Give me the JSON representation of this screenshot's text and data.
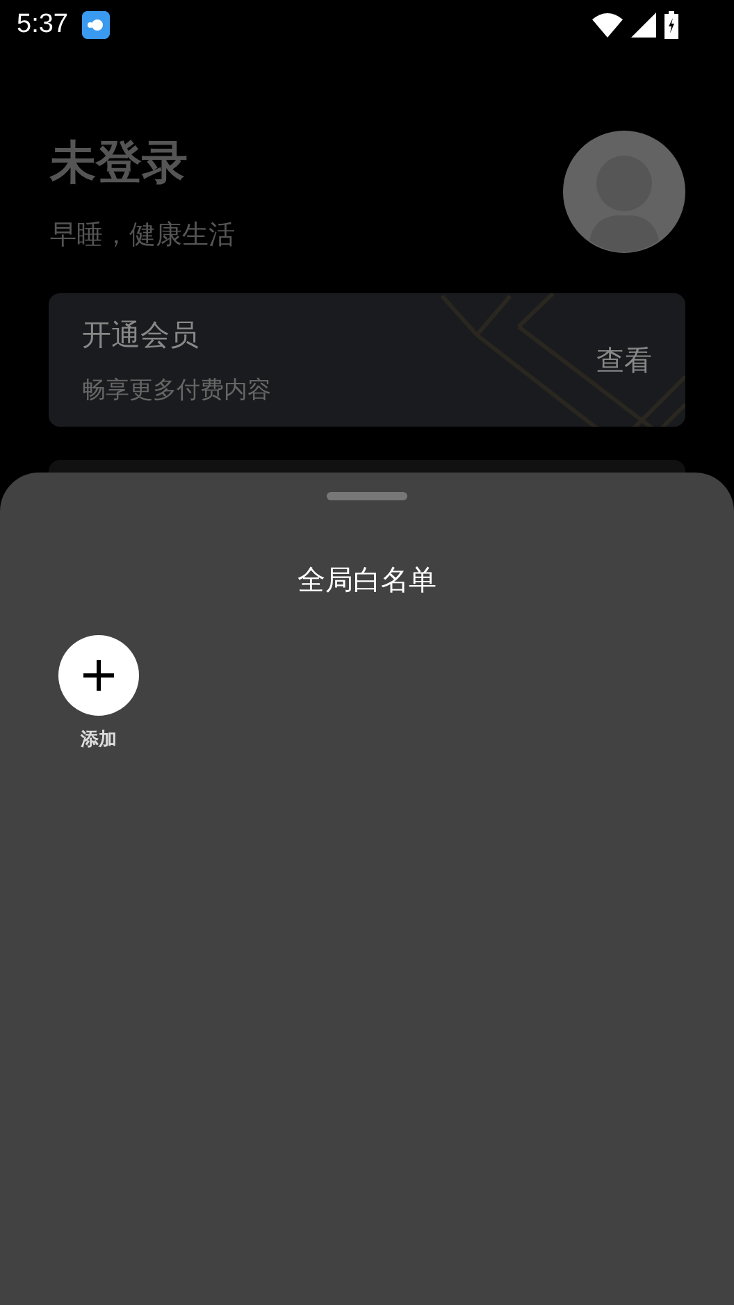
{
  "status_bar": {
    "time": "5:37"
  },
  "profile": {
    "name": "未登录",
    "slogan": "早睡，健康生活"
  },
  "membership_card": {
    "title": "开通会员",
    "subtitle": "畅享更多付费内容",
    "action": "查看"
  },
  "sheet": {
    "title": "全局白名单",
    "items": [
      {
        "kind": "add",
        "label": "添加"
      }
    ]
  }
}
